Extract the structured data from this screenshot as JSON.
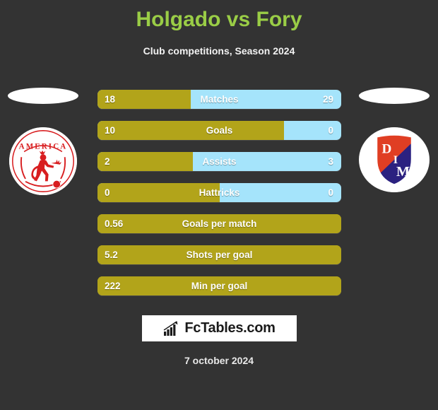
{
  "header": {
    "title": "Holgado vs Fory",
    "subtitle": "Club competitions, Season 2024",
    "title_color": "#9ACD46"
  },
  "teams": {
    "left": {
      "crest_name": "america-de-cali-crest",
      "crest_text": "AMERICA",
      "colors": {
        "primary": "#D81E20",
        "background": "#FFFFFF"
      }
    },
    "right": {
      "crest_name": "independiente-medellin-crest",
      "letters": [
        "D",
        "I",
        "M"
      ],
      "colors": {
        "red": "#E03E23",
        "blue": "#2B2180",
        "background": "#FFFFFF"
      }
    }
  },
  "palette": {
    "background": "#333333",
    "bar_left": "#B2A41A",
    "bar_right": "#A5E4FB",
    "text": "#FFFFFF"
  },
  "stats": [
    {
      "label": "Matches",
      "left": "18",
      "right": "29",
      "left_pct": 38.3,
      "dual": true
    },
    {
      "label": "Goals",
      "left": "10",
      "right": "0",
      "left_pct": 76.5,
      "dual": true
    },
    {
      "label": "Assists",
      "left": "2",
      "right": "3",
      "left_pct": 39.1,
      "dual": true
    },
    {
      "label": "Hattricks",
      "left": "0",
      "right": "0",
      "left_pct": 50.0,
      "dual": true
    },
    {
      "label": "Goals per match",
      "left": "0.56",
      "right": "",
      "left_pct": 100,
      "dual": false
    },
    {
      "label": "Shots per goal",
      "left": "5.2",
      "right": "",
      "left_pct": 100,
      "dual": false
    },
    {
      "label": "Min per goal",
      "left": "222",
      "right": "",
      "left_pct": 100,
      "dual": false
    }
  ],
  "footer": {
    "brand_text": "FcTables.com",
    "brand_icon": "bar-chart-growth-icon",
    "date": "7 october 2024"
  }
}
